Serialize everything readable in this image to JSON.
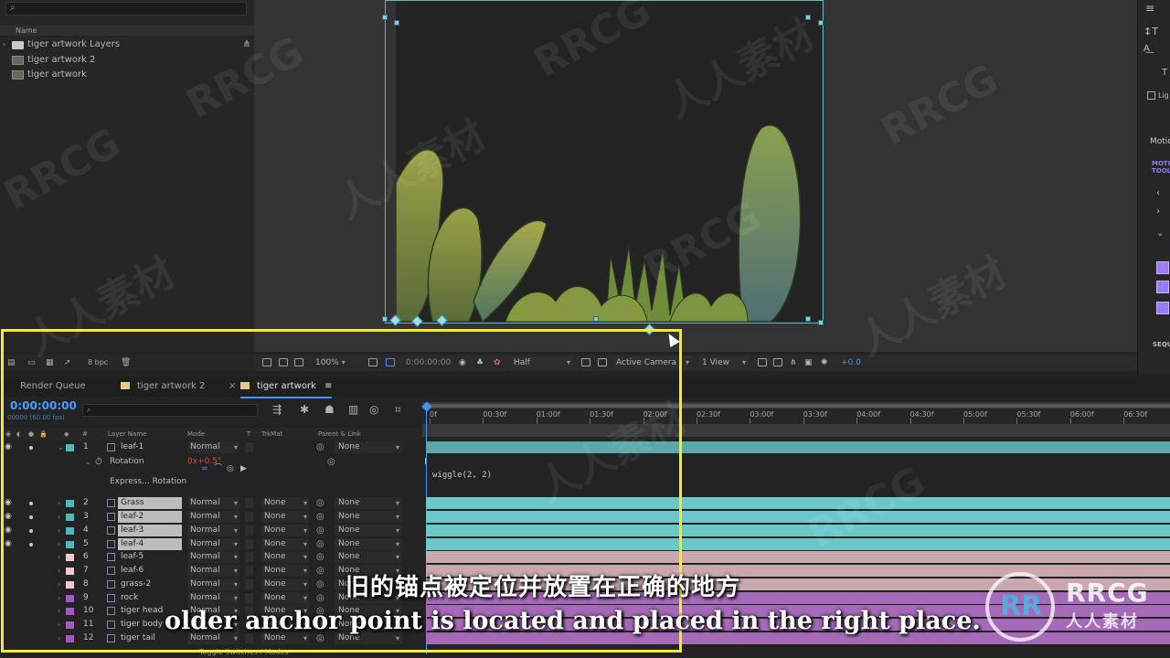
{
  "project": {
    "column_name": "Name",
    "items": [
      {
        "label": "tiger artwork Layers",
        "kind": "folder"
      },
      {
        "label": "tiger artwork 2",
        "kind": "comp"
      },
      {
        "label": "tiger artwork",
        "kind": "comp"
      }
    ],
    "bpc": "8 bpc"
  },
  "viewer": {
    "zoom": "100%",
    "timecode": "0:00:00:00",
    "resolution": "Half",
    "camera": "Active Camera",
    "view": "1 View",
    "exposure": "+0.0"
  },
  "right_panel": {
    "motion_label": "Motio",
    "motion_tools": "MOTI\nTOOL",
    "seq_label": "SEQU",
    "lig_label": "Lig"
  },
  "timeline": {
    "tabs": [
      {
        "label": "Render Queue"
      },
      {
        "label": "tiger artwork 2"
      },
      {
        "label": "tiger artwork"
      }
    ],
    "timecode": "0:00:00:00",
    "fps": "00000 (60.00 fps)",
    "columns": {
      "layer_name": "Layer Name",
      "mode": "Mode",
      "t": "T",
      "trkmat": "TrkMat",
      "parent": "Parent & Link"
    },
    "ruler_ticks": [
      "0f",
      "00:30f",
      "01:00f",
      "01:30f",
      "02:00f",
      "02:30f",
      "03:00f",
      "03:30f",
      "04:00f",
      "04:30f",
      "05:00f",
      "05:30f",
      "06:00f",
      "06:30f"
    ],
    "layers": [
      {
        "num": "1",
        "name": "leaf-1",
        "mode": "Normal",
        "trkmat": "",
        "parent": "None",
        "label_color": "#4fb8be",
        "bar_color": "#5aa8a8",
        "selected": false,
        "visible": true
      },
      {
        "num": "2",
        "name": "Grass",
        "mode": "Normal",
        "trkmat": "None",
        "parent": "None",
        "label_color": "#4fb8be",
        "bar_color": "#6cc7c9",
        "selected": true,
        "visible": true
      },
      {
        "num": "3",
        "name": "leaf-2",
        "mode": "Normal",
        "trkmat": "None",
        "parent": "None",
        "label_color": "#4fb8be",
        "bar_color": "#6cc7c9",
        "selected": true,
        "visible": true
      },
      {
        "num": "4",
        "name": "leaf-3",
        "mode": "Normal",
        "trkmat": "None",
        "parent": "None",
        "label_color": "#4fb8be",
        "bar_color": "#6cc7c9",
        "selected": true,
        "visible": true
      },
      {
        "num": "5",
        "name": "leaf-4",
        "mode": "Normal",
        "trkmat": "None",
        "parent": "None",
        "label_color": "#4fb8be",
        "bar_color": "#6cc7c9",
        "selected": true,
        "visible": true
      },
      {
        "num": "6",
        "name": "leaf-5",
        "mode": "Normal",
        "trkmat": "None",
        "parent": "None",
        "label_color": "#f0c8cf",
        "bar_color": "#c9a9ae",
        "selected": false,
        "visible": false
      },
      {
        "num": "7",
        "name": "leaf-6",
        "mode": "Normal",
        "trkmat": "None",
        "parent": "None",
        "label_color": "#f0c8cf",
        "bar_color": "#c9a9ae",
        "selected": false,
        "visible": false
      },
      {
        "num": "8",
        "name": "grass-2",
        "mode": "Normal",
        "trkmat": "None",
        "parent": "None",
        "label_color": "#f0c8cf",
        "bar_color": "#c9a9ae",
        "selected": false,
        "visible": false
      },
      {
        "num": "9",
        "name": "rock",
        "mode": "Normal",
        "trkmat": "None",
        "parent": "None",
        "label_color": "#a25ac0",
        "bar_color": "#a46ab8",
        "selected": false,
        "visible": false
      },
      {
        "num": "10",
        "name": "tiger head",
        "mode": "Normal",
        "trkmat": "None",
        "parent": "None",
        "label_color": "#a25ac0",
        "bar_color": "#a46ab8",
        "selected": false,
        "visible": false
      },
      {
        "num": "11",
        "name": "tiger body",
        "mode": "Normal",
        "trkmat": "None",
        "parent": "None",
        "label_color": "#a25ac0",
        "bar_color": "#a46ab8",
        "selected": false,
        "visible": false
      },
      {
        "num": "12",
        "name": "tiger tail",
        "mode": "Normal",
        "trkmat": "None",
        "parent": "None",
        "label_color": "#a25ac0",
        "bar_color": "#a46ab8",
        "selected": false,
        "visible": false
      }
    ],
    "rotation_label": "Rotation",
    "rotation_value": "0x+0.5°",
    "expression_label": "Express... Rotation",
    "expression_text": "wiggle(2, 2)",
    "toggle_label": "Toggle Switches / Modes"
  },
  "subtitles": {
    "chinese": "旧的锚点被定位并放置在正确的地方",
    "english": "older anchor point is located and placed in the right place."
  },
  "watermark": {
    "text_a": "RRCG",
    "text_b": "人人素材"
  },
  "logo": {
    "mark": "RR",
    "title": "RRCG",
    "subtitle": "人人素材"
  },
  "colors": {
    "accent_blue": "#4b8ff0",
    "highlight_yellow": "#f2ec2c",
    "teal_bar": "#6cc7c9",
    "pink_bar": "#c9a9ae",
    "purple_bar": "#a46ab8"
  }
}
